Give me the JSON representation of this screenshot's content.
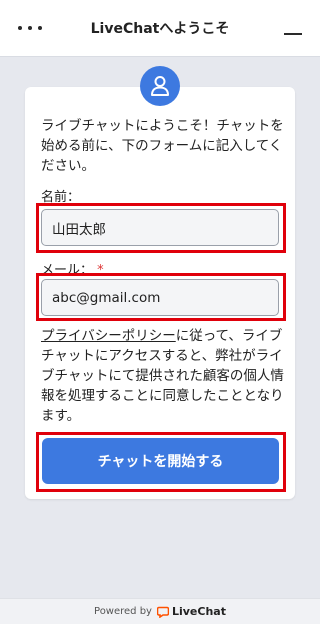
{
  "header": {
    "title": "LiveChatへようこそ",
    "menu_icon": "more-dots-icon",
    "minimize_icon": "minimize-icon"
  },
  "form": {
    "avatar_icon": "user-icon",
    "intro": "ライブチャットにようこそ！チャットを始める前に、下のフォームに記入してください。",
    "name_label": "名前：",
    "name_value": "山田太郎",
    "email_label": "メール：",
    "email_required_mark": "*",
    "email_value": "abc@gmail.com",
    "privacy_link": "プライバシーポリシー",
    "privacy_text": "に従って、ライブチャットにアクセスすると、弊社がライブチャットにて提供された顧客の個人情報を処理することに同意したこととなります。",
    "submit_label": "チャットを開始する"
  },
  "footer": {
    "powered_by": "Powered by",
    "brand": "LiveChat",
    "brand_color": "#ff5100"
  },
  "colors": {
    "accent": "#3d79e0",
    "highlight_border": "#e0000b"
  }
}
